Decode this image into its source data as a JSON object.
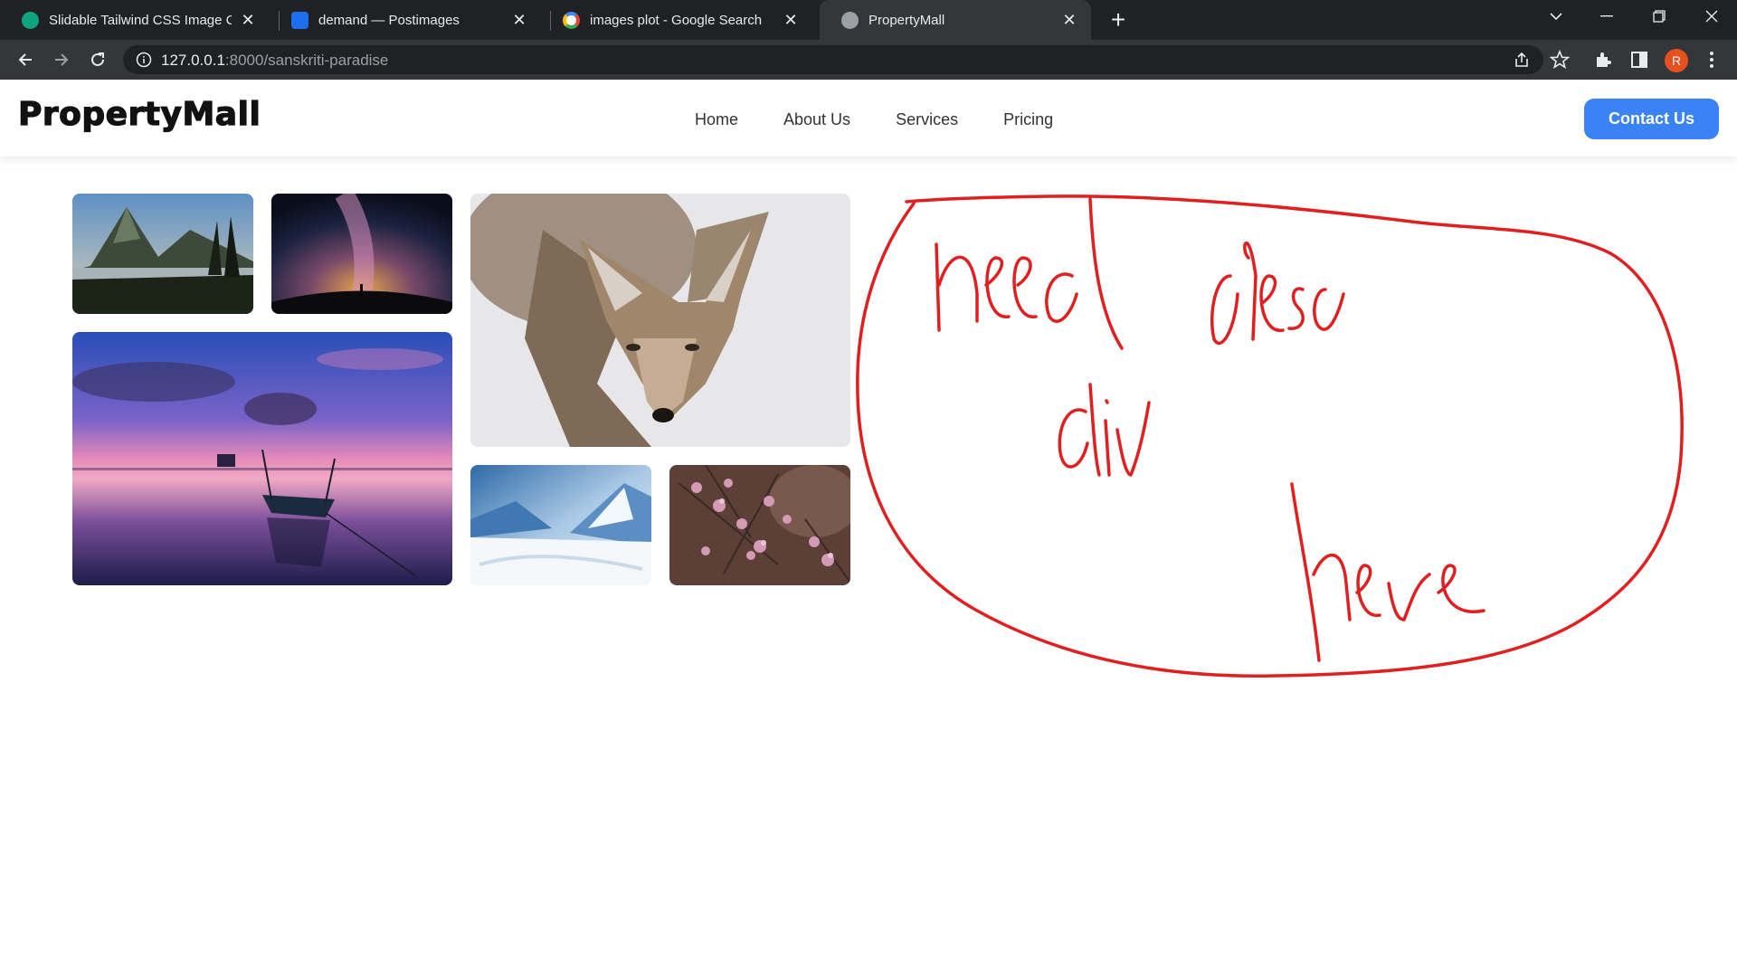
{
  "browser": {
    "tabs": [
      {
        "title": "Slidable Tailwind CSS Image Caro",
        "favicon": "chatgpt-icon"
      },
      {
        "title": "demand — Postimages",
        "favicon": "postimages-icon"
      },
      {
        "title": "images plot - Google Search",
        "favicon": "google-icon"
      },
      {
        "title": "PropertyMall",
        "favicon": "globe-icon",
        "active": true
      }
    ],
    "address": {
      "host": "127.0.0.1",
      "path": ":8000/sanskriti-paradise"
    },
    "profile_initial": "R"
  },
  "site": {
    "brand": "PropertyMall",
    "nav": [
      "Home",
      "About Us",
      "Services",
      "Pricing"
    ],
    "cta": "Contact Us",
    "accent": "#3b82f6"
  },
  "gallery": [
    {
      "subject": "mountain-lake"
    },
    {
      "subject": "milky-way-night-sky"
    },
    {
      "subject": "coyote"
    },
    {
      "subject": "sunset-boat-on-lake"
    },
    {
      "subject": "snowy-mountains"
    },
    {
      "subject": "pink-blossoms"
    }
  ],
  "annotation": {
    "text": "need desc div here",
    "color": "#e02020"
  }
}
